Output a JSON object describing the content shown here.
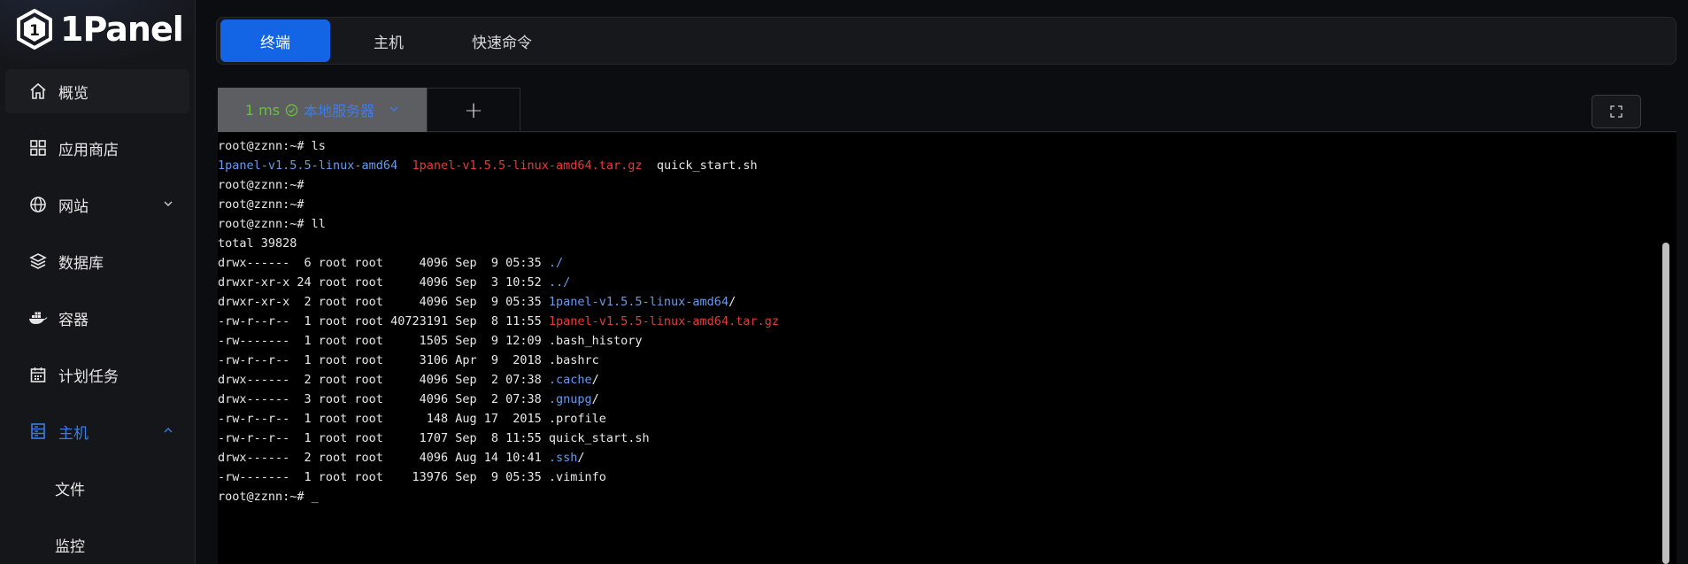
{
  "app": {
    "name": "1Panel"
  },
  "colors": {
    "accent": "#1464e6",
    "active_text": "#3d7ce6",
    "success": "#67c23a",
    "file_blue": "#6a9be8",
    "archive_red": "#e03c3c"
  },
  "sidebar": {
    "items": [
      {
        "label": "概览",
        "icon": "home-icon"
      },
      {
        "label": "应用商店",
        "icon": "grid-icon"
      },
      {
        "label": "网站",
        "icon": "globe-icon",
        "expandable": true
      },
      {
        "label": "数据库",
        "icon": "layers-icon"
      },
      {
        "label": "容器",
        "icon": "docker-icon"
      },
      {
        "label": "计划任务",
        "icon": "calendar-icon"
      },
      {
        "label": "主机",
        "icon": "server-icon",
        "expanded": true,
        "active": true
      }
    ],
    "subitems": [
      {
        "label": "文件"
      },
      {
        "label": "监控"
      }
    ]
  },
  "top_tabs": [
    {
      "label": "终端",
      "active": true
    },
    {
      "label": "主机"
    },
    {
      "label": "快速命令"
    }
  ],
  "session": {
    "latency": "1 ms",
    "status_icon": "check-circle-icon",
    "server": "本地服务器",
    "add_label": "+"
  },
  "terminal": {
    "lines": [
      [
        {
          "t": "root@zznn:~# ls"
        }
      ],
      [
        {
          "t": "1panel-v1.5.5-linux-amd64",
          "c": "blue"
        },
        {
          "t": "  "
        },
        {
          "t": "1panel-v1.5.5-linux-amd64.tar.gz",
          "c": "red"
        },
        {
          "t": "  quick_start.sh"
        }
      ],
      [
        {
          "t": "root@zznn:~#"
        }
      ],
      [
        {
          "t": "root@zznn:~#"
        }
      ],
      [
        {
          "t": "root@zznn:~# ll"
        }
      ],
      [
        {
          "t": "total 39828"
        }
      ],
      [
        {
          "t": "drwx------  6 root root     4096 Sep  9 05:35 "
        },
        {
          "t": "./",
          "c": "blue"
        }
      ],
      [
        {
          "t": "drwxr-xr-x 24 root root     4096 Sep  3 10:52 "
        },
        {
          "t": "../",
          "c": "blue"
        }
      ],
      [
        {
          "t": "drwxr-xr-x  2 root root     4096 Sep  9 05:35 "
        },
        {
          "t": "1panel-v1.5.5-linux-amd64",
          "c": "blue"
        },
        {
          "t": "/"
        }
      ],
      [
        {
          "t": "-rw-r--r--  1 root root 40723191 Sep  8 11:55 "
        },
        {
          "t": "1panel-v1.5.5-linux-amd64.tar.gz",
          "c": "red"
        }
      ],
      [
        {
          "t": "-rw-------  1 root root     1505 Sep  9 12:09 .bash_history"
        }
      ],
      [
        {
          "t": "-rw-r--r--  1 root root     3106 Apr  9  2018 .bashrc"
        }
      ],
      [
        {
          "t": "drwx------  2 root root     4096 Sep  2 07:38 "
        },
        {
          "t": ".cache",
          "c": "blue"
        },
        {
          "t": "/"
        }
      ],
      [
        {
          "t": "drwx------  3 root root     4096 Sep  2 07:38 "
        },
        {
          "t": ".gnupg",
          "c": "blue"
        },
        {
          "t": "/"
        }
      ],
      [
        {
          "t": "-rw-r--r--  1 root root      148 Aug 17  2015 .profile"
        }
      ],
      [
        {
          "t": "-rw-r--r--  1 root root     1707 Sep  8 11:55 quick_start.sh"
        }
      ],
      [
        {
          "t": "drwx------  2 root root     4096 Aug 14 10:41 "
        },
        {
          "t": ".ssh",
          "c": "blue"
        },
        {
          "t": "/"
        }
      ],
      [
        {
          "t": "-rw-------  1 root root    13976 Sep  9 05:35 .viminfo"
        }
      ],
      [
        {
          "t": "root@zznn:~# _"
        }
      ]
    ]
  }
}
